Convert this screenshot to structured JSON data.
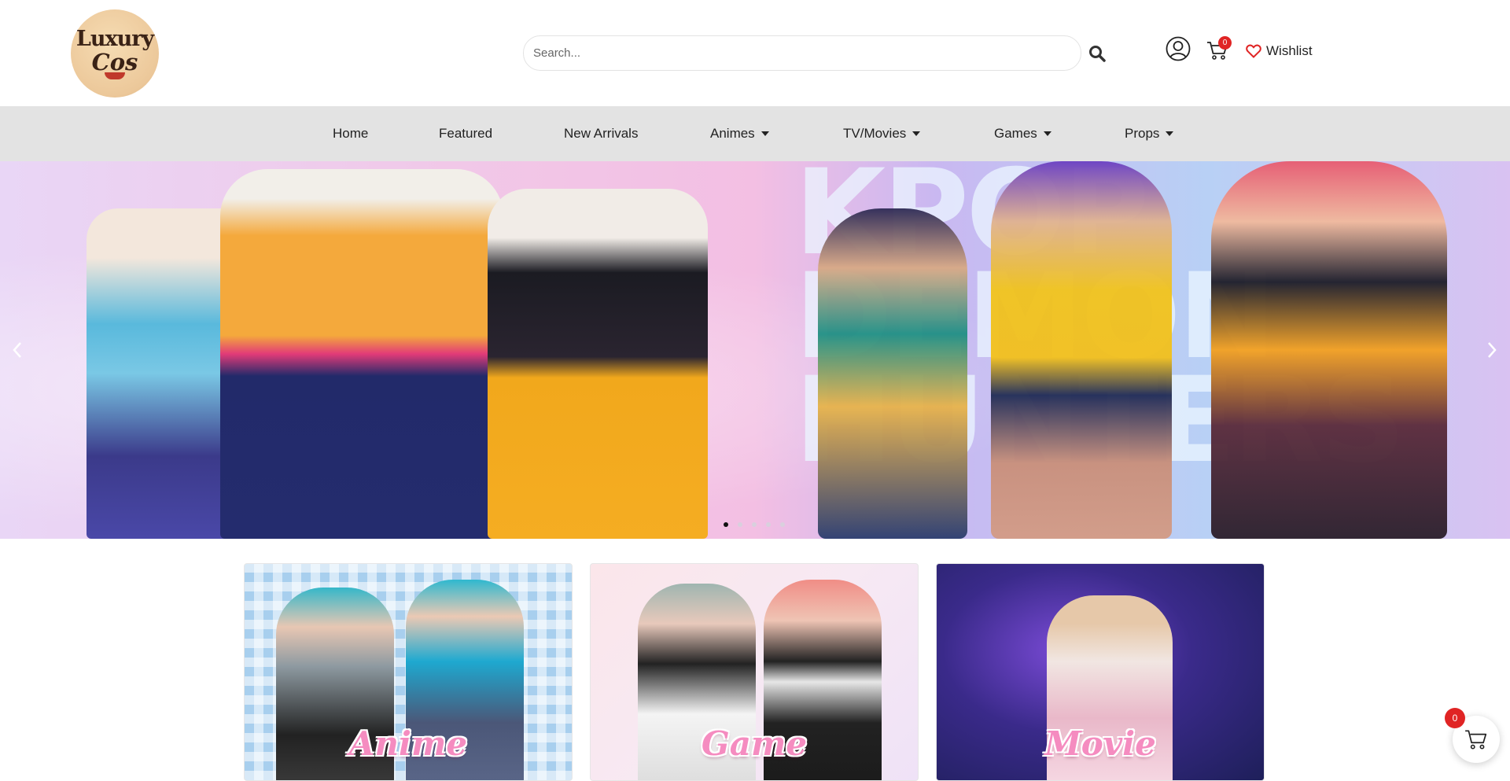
{
  "logo": {
    "line1": "Luxury",
    "line2": "Cos"
  },
  "search": {
    "placeholder": "Search..."
  },
  "cart": {
    "count": "0"
  },
  "wishlist": {
    "label": "Wishlist"
  },
  "nav": {
    "items": [
      {
        "label": "Home"
      },
      {
        "label": "Featured"
      },
      {
        "label": "New Arrivals"
      },
      {
        "label": "Animes"
      },
      {
        "label": "TV/Movies"
      },
      {
        "label": "Games"
      },
      {
        "label": "Props"
      }
    ]
  },
  "hero": {
    "background_text": "KPOP DEMON HUNTERS",
    "slide_count": 5,
    "active_slide": 1
  },
  "categories": [
    {
      "label": "Anime"
    },
    {
      "label": "Game"
    },
    {
      "label": "Movie"
    }
  ],
  "floating_cart": {
    "count": "0"
  },
  "colors": {
    "accent_red": "#e02424",
    "nav_bg": "#e3e3e3",
    "category_label": "#f58cc0"
  },
  "icons": [
    "search-icon",
    "account-icon",
    "cart-icon",
    "heart-icon",
    "chevron-left-icon",
    "chevron-right-icon"
  ]
}
